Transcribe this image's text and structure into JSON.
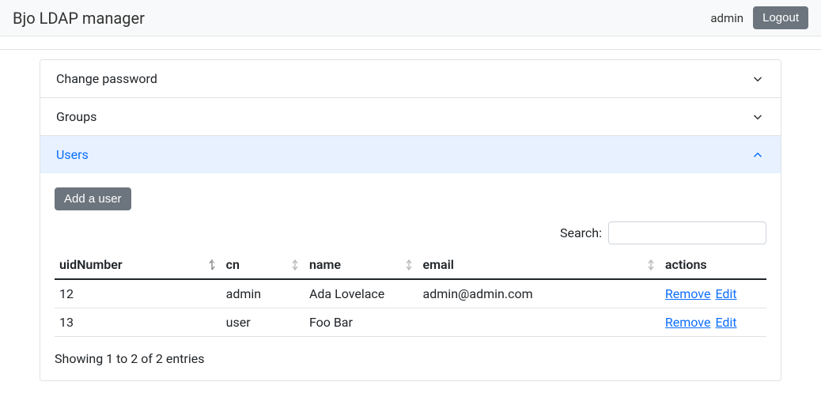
{
  "navbar": {
    "brand": "Bjo LDAP manager",
    "user": "admin",
    "logout": "Logout"
  },
  "accordion": {
    "password_header": "Change password",
    "groups_header": "Groups",
    "users_header": "Users"
  },
  "users_panel": {
    "add_button": "Add a user",
    "search_label": "Search:",
    "search_value": "",
    "columns": {
      "uidNumber": "uidNumber",
      "cn": "cn",
      "name": "name",
      "email": "email",
      "actions": "actions"
    },
    "rows": [
      {
        "uidNumber": "12",
        "cn": "admin",
        "name": "Ada Lovelace",
        "email": "admin@admin.com",
        "remove": "Remove",
        "edit": "Edit"
      },
      {
        "uidNumber": "13",
        "cn": "user",
        "name": "Foo Bar",
        "email": "",
        "remove": "Remove",
        "edit": "Edit"
      }
    ],
    "info": "Showing 1 to 2 of 2 entries"
  }
}
